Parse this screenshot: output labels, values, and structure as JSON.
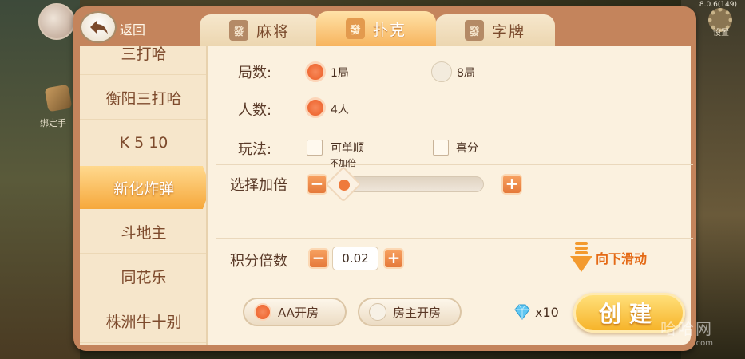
{
  "header": {
    "back_label": "返回",
    "version": "8.0.6(149)",
    "settings_label": "设置"
  },
  "background": {
    "bind_label": "绑定手"
  },
  "tabs": [
    {
      "label": "麻将",
      "tile": "發",
      "active": false
    },
    {
      "label": "扑克",
      "tile": "發",
      "active": true
    },
    {
      "label": "字牌",
      "tile": "發",
      "active": false
    }
  ],
  "sidebar": {
    "items": [
      {
        "label": "三打哈",
        "active": false
      },
      {
        "label": "衡阳三打哈",
        "active": false
      },
      {
        "label": "K 5 10",
        "active": false
      },
      {
        "label": "新化炸弹",
        "active": true
      },
      {
        "label": "斗地主",
        "active": false
      },
      {
        "label": "同花乐",
        "active": false
      },
      {
        "label": "株洲牛十别",
        "active": false
      }
    ]
  },
  "rounds": {
    "label": "局数:",
    "options": [
      {
        "label": "1局",
        "selected": true
      },
      {
        "label": "8局",
        "selected": false
      }
    ]
  },
  "players": {
    "label": "人数:",
    "options": [
      {
        "label": "4人",
        "selected": true
      }
    ]
  },
  "play": {
    "label": "玩法:",
    "options": [
      {
        "label": "可单顺",
        "checked": false
      },
      {
        "label": "喜分",
        "checked": false
      }
    ]
  },
  "multiplier": {
    "label": "选择加倍",
    "value_label": "不加倍",
    "minus": "−",
    "plus": "+",
    "level": 0
  },
  "score": {
    "label": "积分倍数",
    "value": "0.02",
    "minus": "−",
    "plus": "+"
  },
  "scroll_hint": {
    "label": "向下滑动"
  },
  "payment": {
    "options": [
      {
        "label": "AA开房",
        "selected": true
      },
      {
        "label": "房主开房",
        "selected": false
      }
    ]
  },
  "cost": {
    "label": "x10",
    "icon": "diamond-icon"
  },
  "create": {
    "label": "创建"
  },
  "watermark": {
    "text": "哈哈网",
    "sub": "com"
  },
  "colors": {
    "accent": "#f0743a",
    "panel": "#c4845c",
    "content": "#fbf1df",
    "create": "#f6b42a"
  }
}
